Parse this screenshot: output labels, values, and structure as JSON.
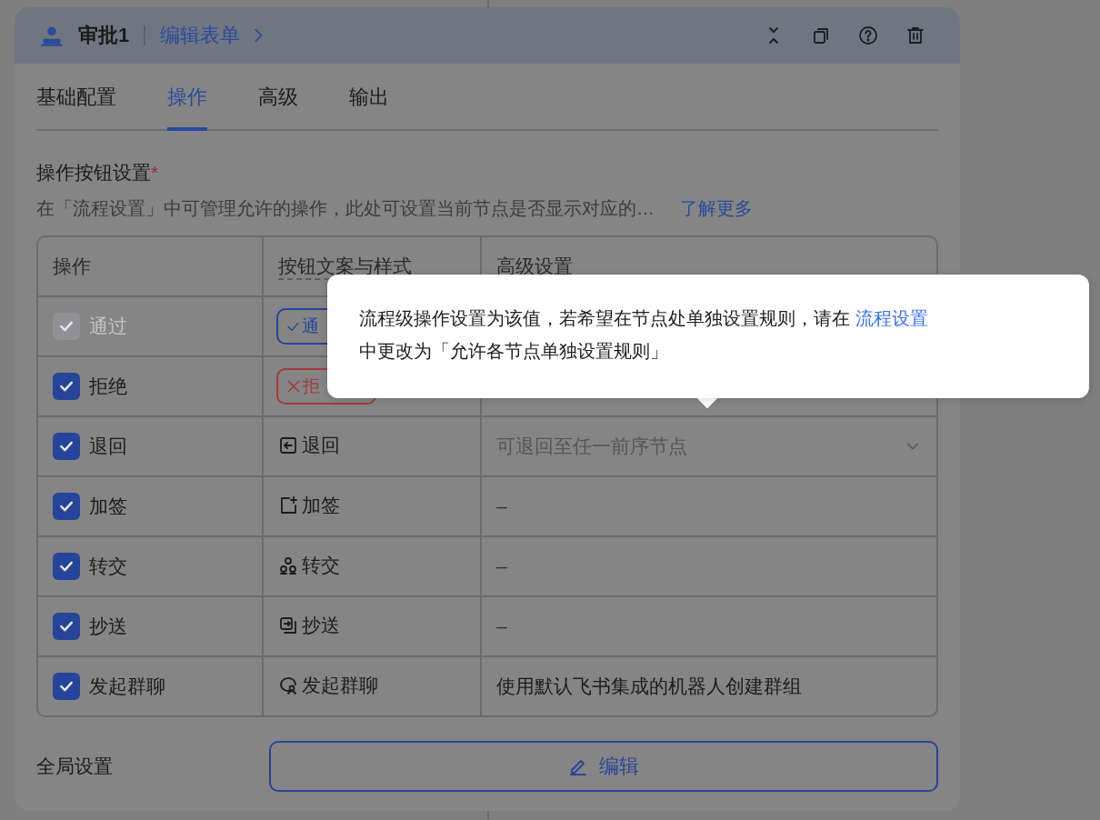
{
  "node": {
    "title": "审批1",
    "edit_link": "编辑表单"
  },
  "tabs": [
    {
      "label": "基础配置",
      "selected": false
    },
    {
      "label": "操作",
      "selected": true
    },
    {
      "label": "高级",
      "selected": false
    },
    {
      "label": "输出",
      "selected": false
    }
  ],
  "section": {
    "label": "操作按钮设置",
    "required_mark": "*",
    "description": "在「流程设置」中可管理允许的操作，此处可设置当前节点是否显示对应的…",
    "learn_more": "了解更多"
  },
  "table": {
    "columns": [
      "操作",
      "按钮文案与样式",
      "高级设置"
    ],
    "rows": [
      {
        "action": "通过",
        "checked": true,
        "disabled": true,
        "button": {
          "kind": "approve",
          "label": "通"
        }
      },
      {
        "action": "拒绝",
        "checked": true,
        "disabled": false,
        "button": {
          "kind": "reject",
          "label": "拒"
        }
      },
      {
        "action": "退回",
        "checked": true,
        "disabled": false,
        "button": {
          "kind": "return",
          "label": "退回"
        },
        "advanced": {
          "kind": "select",
          "text": "可退回至任一前序节点"
        }
      },
      {
        "action": "加签",
        "checked": true,
        "disabled": false,
        "button": {
          "kind": "add_sign",
          "label": "加签"
        },
        "advanced": {
          "kind": "empty",
          "text": "–"
        }
      },
      {
        "action": "转交",
        "checked": true,
        "disabled": false,
        "button": {
          "kind": "transfer",
          "label": "转交"
        },
        "advanced": {
          "kind": "empty",
          "text": "–"
        }
      },
      {
        "action": "抄送",
        "checked": true,
        "disabled": false,
        "button": {
          "kind": "cc",
          "label": "抄送"
        },
        "advanced": {
          "kind": "empty",
          "text": "–"
        }
      },
      {
        "action": "发起群聊",
        "checked": true,
        "disabled": false,
        "button": {
          "kind": "group_chat",
          "label": "发起群聊"
        },
        "advanced": {
          "kind": "text",
          "text": "使用默认飞书集成的机器人创建群组"
        }
      }
    ]
  },
  "global": {
    "label": "全局设置",
    "button": "编辑"
  },
  "tooltip": {
    "before": "流程级操作设置为该值，若希望在节点处单独设置规则，请在 ",
    "link": "流程设置",
    "after": "中更改为「允许各节点单独设置规则」"
  }
}
